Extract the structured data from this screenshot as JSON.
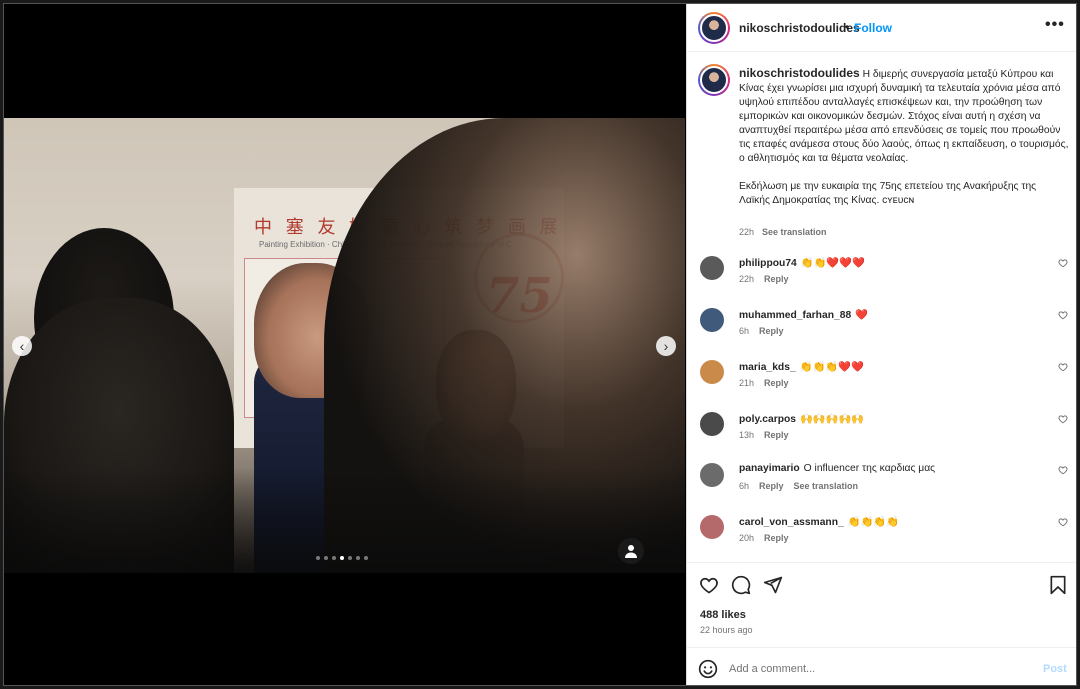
{
  "post": {
    "username": "nikoschristodoulides",
    "follow_label": "Follow",
    "separator": "•",
    "more_label": "•••",
    "caption_p1": "Η διμερής συνεργασία μεταξύ Κύπρου και Κίνας έχει γνωρίσει μια ισχυρή δυναμική τα τελευταία χρόνια μέσα από υψηλού επιπέδου ανταλλαγές επισκέψεων και, την προώθηση των εμπορικών και οικονομικών δεσμών. Στόχος είναι αυτή η σχέση να αναπτυχθεί περαιτέρω μέσα από επενδύσεις σε τομείς που προωθούν τις επαφές ανάμεσα στους δύο λαούς, όπως η εκπαίδευση, ο τουρισμός, ο αθλητισμός και τα θέματα νεολαίας.",
    "caption_p2": "Εκδήλωση με την ευκαιρία της 75ης επετείου της Ανακήρυξης της Λαϊκής Δημοκρατίας της Κίνας. ᴄʏᴇᴜᴄɴ",
    "caption_time": "22h",
    "caption_translation": "See translation",
    "likes": "488 likes",
    "time_ago": "22 hours ago"
  },
  "media": {
    "banner_text": "中 塞 友 好 童 心 筑 梦 画 展",
    "banner_sub": "Painting Exhibition · China-Cyprus Friendship · Shared Aspirations of C",
    "poster_number": "75",
    "slide_count": 7,
    "active_slide": 3
  },
  "comments": [
    {
      "username": "philippou74",
      "text": "👏👏❤️❤️❤️",
      "time": "22h",
      "reply": "Reply",
      "translation": "",
      "avatar_color": "#5a5a5a"
    },
    {
      "username": "muhammed_farhan_88",
      "text": "❤️",
      "time": "6h",
      "reply": "Reply",
      "translation": "",
      "avatar_color": "#3f5a7a"
    },
    {
      "username": "maria_kds_",
      "text": "👏👏👏❤️❤️",
      "time": "21h",
      "reply": "Reply",
      "translation": "",
      "avatar_color": "#c98a4a"
    },
    {
      "username": "poly.carpos",
      "text": "🙌🙌🙌🙌🙌",
      "time": "13h",
      "reply": "Reply",
      "translation": "",
      "avatar_color": "#4a4a4a"
    },
    {
      "username": "panayimario",
      "text": "Ο influencer της καρδιας μας",
      "time": "6h",
      "reply": "Reply",
      "translation": "See translation",
      "avatar_color": "#6b6b6b"
    },
    {
      "username": "carol_von_assmann_",
      "text": "👏👏👏👏",
      "time": "20h",
      "reply": "Reply",
      "translation": "",
      "avatar_color": "#b46a6a"
    }
  ],
  "add_comment": {
    "placeholder": "Add a comment...",
    "post_label": "Post"
  },
  "icons": {
    "like": "heart-icon",
    "comment": "comment-bubble-icon",
    "share": "paper-plane-icon",
    "save": "bookmark-icon",
    "emoji": "emoji-smile-icon",
    "prev": "chevron-left-icon",
    "next": "chevron-right-icon",
    "tags": "tag-people-icon"
  },
  "colors": {
    "accent": "#0095f6",
    "muted": "#737373",
    "post_disabled": "#b3dbff",
    "heart_red": "#ed4956"
  }
}
